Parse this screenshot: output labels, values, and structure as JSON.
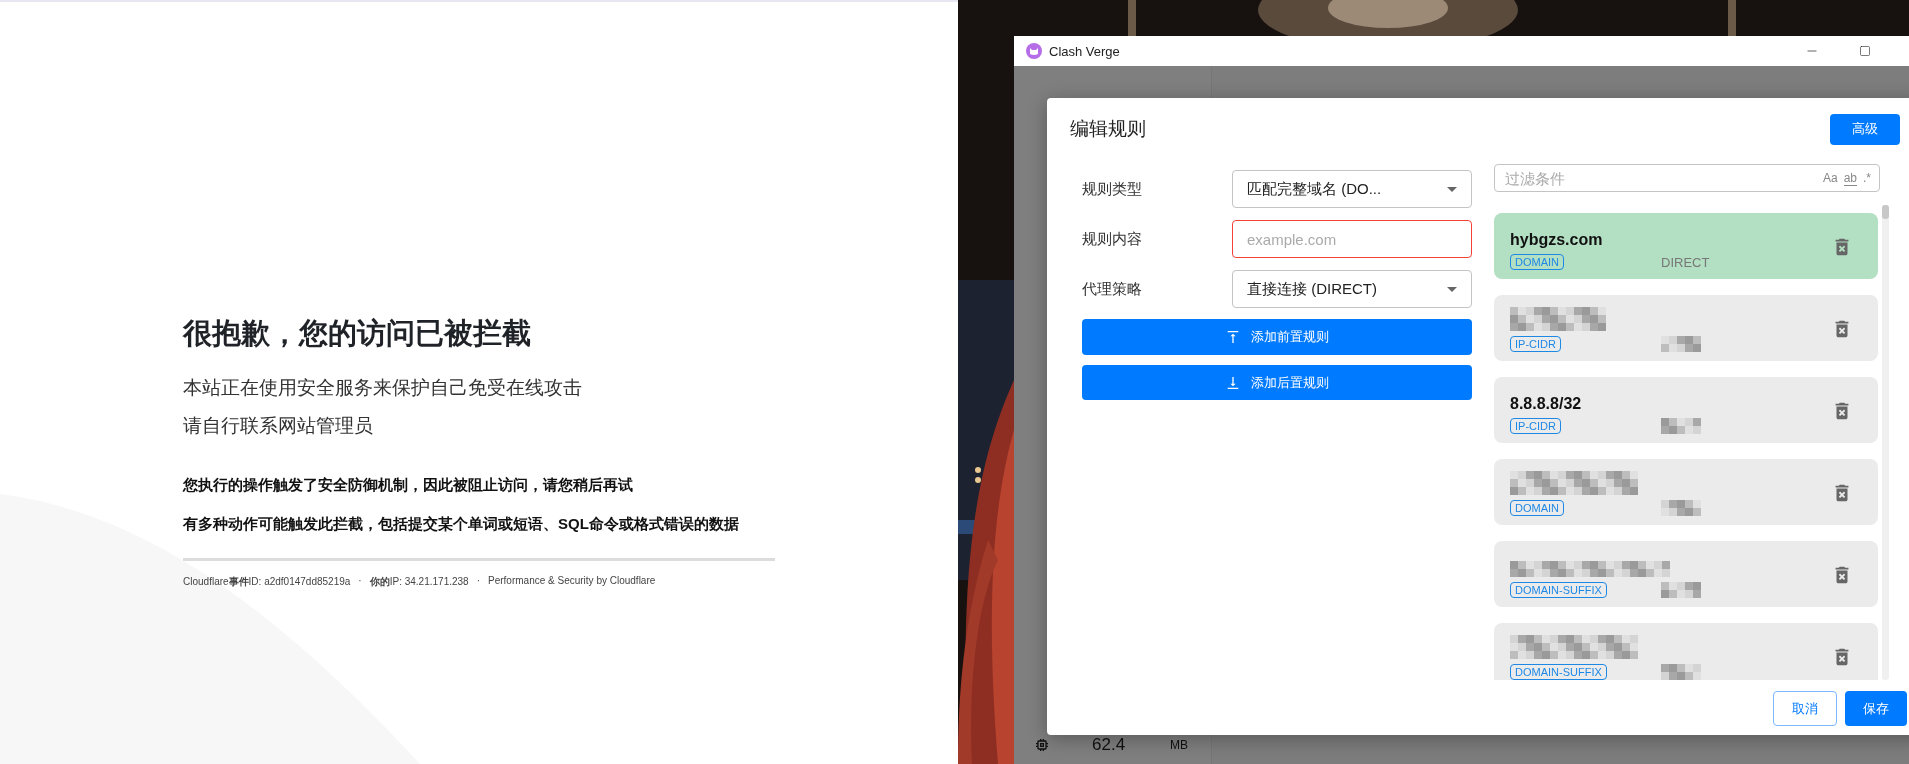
{
  "block_page": {
    "heading": "很抱歉，您的访问已被拦截",
    "lines": [
      "本站正在使用安全服务来保护自己免受在线攻击",
      "请自行联系网站管理员"
    ],
    "details": [
      "您执行的操作触发了安全防御机制，因此被阻止访问，请您稍后再试",
      "有多种动作可能触发此拦截，包括提交某个单词或短语、SQL命令或格式错误的数据"
    ],
    "footer": [
      "Cloudflare**事件**ID: a2df0147dd85219a",
      "·",
      "**你的**IP: 34.21.171.238",
      "·",
      "Performance & Security by Cloudflare"
    ]
  },
  "window": {
    "title": "Clash Verge"
  },
  "memory": {
    "value": "62.4",
    "unit": "MB"
  },
  "dialog": {
    "title": "编辑规则",
    "advanced_button": "高级",
    "fields": [
      {
        "kind": "select",
        "label": "规则类型",
        "value": "匹配完整域名 (DO...",
        "error": false
      },
      {
        "kind": "input",
        "label": "规则内容",
        "placeholder": "example.com",
        "error": true
      },
      {
        "kind": "select",
        "label": "代理策略",
        "value": "直接连接 (DIRECT)",
        "error": false
      }
    ],
    "actions": [
      {
        "kind": "prepend",
        "label": "添加前置规则"
      },
      {
        "kind": "append",
        "label": "添加后置规则"
      }
    ],
    "filter": {
      "placeholder": "过滤条件",
      "toggles": [
        "Aa",
        "ab",
        ".*"
      ]
    },
    "rules": [
      {
        "title": "hybgzs.com",
        "tag": "DOMAIN",
        "policy": "DIRECT",
        "selected": true
      },
      {
        "tag": "IP-CIDR",
        "selected": false
      },
      {
        "title": "8.8.8.8/32",
        "tag": "IP-CIDR",
        "selected": false
      },
      {
        "tag": "DOMAIN",
        "selected": false
      },
      {
        "tag": "DOMAIN-SUFFIX",
        "selected": false
      },
      {
        "tag": "DOMAIN-SUFFIX",
        "selected": false
      }
    ],
    "buttons": [
      {
        "kind": "cancel",
        "label": "取消"
      },
      {
        "kind": "save",
        "label": "保存"
      }
    ]
  }
}
